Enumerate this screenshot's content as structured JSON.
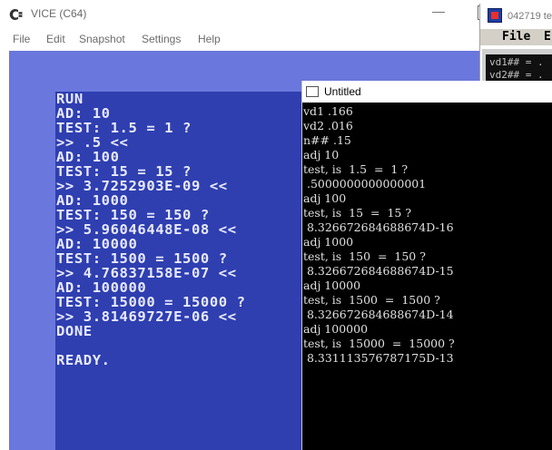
{
  "vice": {
    "title": "VICE (C64)",
    "menu": [
      "File",
      "Edit",
      "Snapshot",
      "Settings",
      "Help"
    ],
    "screen_lines": [
      "RUN",
      "AD: 10",
      "TEST: 1.5 = 1 ?",
      ">> .5 <<",
      "AD: 100",
      "TEST: 15 = 15 ?",
      ">> 3.7252903E-09 <<",
      "AD: 1000",
      "TEST: 150 = 150 ?",
      ">> 5.96046448E-08 <<",
      "AD: 10000",
      "TEST: 1500 = 1500 ?",
      ">> 4.76837158E-07 <<",
      "AD: 100000",
      "TEST: 15000 = 15000 ?",
      ">> 3.81469727E-06 <<",
      "DONE",
      "",
      "READY."
    ],
    "colors": {
      "border": "#6a77dd",
      "screen": "#2f3fb0",
      "text": "#e8eaff"
    }
  },
  "output": {
    "title": "Untitled",
    "lines": [
      "vd1 .166",
      "vd2 .016",
      "n## .15",
      "adj 10",
      "test, is  1.5  =  1 ?",
      " .5000000000000001",
      "adj 100",
      "test, is  15  =  15 ?",
      " 8.326672684688674D-16",
      "adj 1000",
      "test, is  150  =  150 ?",
      " 8.326672684688674D-15",
      "adj 10000",
      "test, is  1500  =  1500 ?",
      " 8.326672684688674D-14",
      "adj 100000",
      "test, is  15000  =  15000 ?",
      " 8.331113576787175D-13"
    ]
  },
  "bg_window": {
    "title": "042719 te",
    "menu_file": "File",
    "menu_edit": "E",
    "lines": [
      "vd1## = .",
      "vd2## = ."
    ]
  }
}
